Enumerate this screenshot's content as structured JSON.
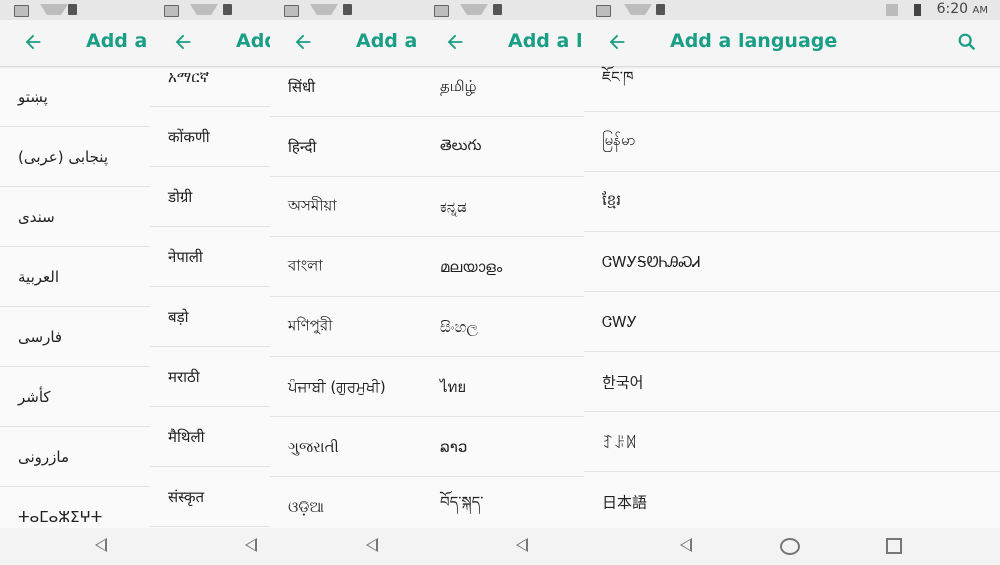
{
  "title": "Add a language",
  "time": "6:20",
  "ampm": "AM",
  "accent_color": "#1a9e86",
  "icons": [
    "image-icon",
    "wifi-icon",
    "sim-icon",
    "back-arrow-icon",
    "search-icon",
    "nav-back-icon",
    "nav-home-icon",
    "nav-recents-icon",
    "battery-icon",
    "no-sim-icon"
  ],
  "panels": [
    {
      "title": "Add a",
      "items": [
        "پښتو",
        "پنجابی (عربی)",
        "سندی",
        "العربية",
        "فارسی",
        "کأشر",
        "مازرونی",
        "ⵜⴰⵎⴰⵣⵉⵖⵜ"
      ]
    },
    {
      "title": "Add a",
      "items": [
        "አማርኛ",
        "कोंकणी",
        "डोग्री",
        "नेपाली",
        "बड़ो",
        "मराठी",
        "मैथिली",
        "संस्कृत"
      ]
    },
    {
      "title": "Add a",
      "items": [
        "सिंधी",
        "हिन्दी",
        "অসমীয়া",
        "বাংলা",
        "মণিপুরী",
        "ਪੰਜਾਬੀ (ਗੁਰਮੁਖੀ)",
        "ગુજરાતી",
        "ଓଡ଼ିଆ"
      ]
    },
    {
      "title": "Add a l",
      "items": [
        "தமிழ்",
        "తెలుగు",
        "ಕನ್ನಡ",
        "മലയാളം",
        "සිංහල",
        "ไทย",
        "ລາວ",
        "བོད་སྐད་"
      ]
    },
    {
      "title": "Add a language",
      "items": [
        "ཇོང་ཁ",
        "မြန်မာ",
        "ខ្មែរ",
        "ᏣᎳᎩᎦᏬᏂᎯᏍᏗ",
        "ᏣᎳᎩ",
        "한국어",
        "ꆈꌠꉙ",
        "日本語"
      ]
    }
  ]
}
